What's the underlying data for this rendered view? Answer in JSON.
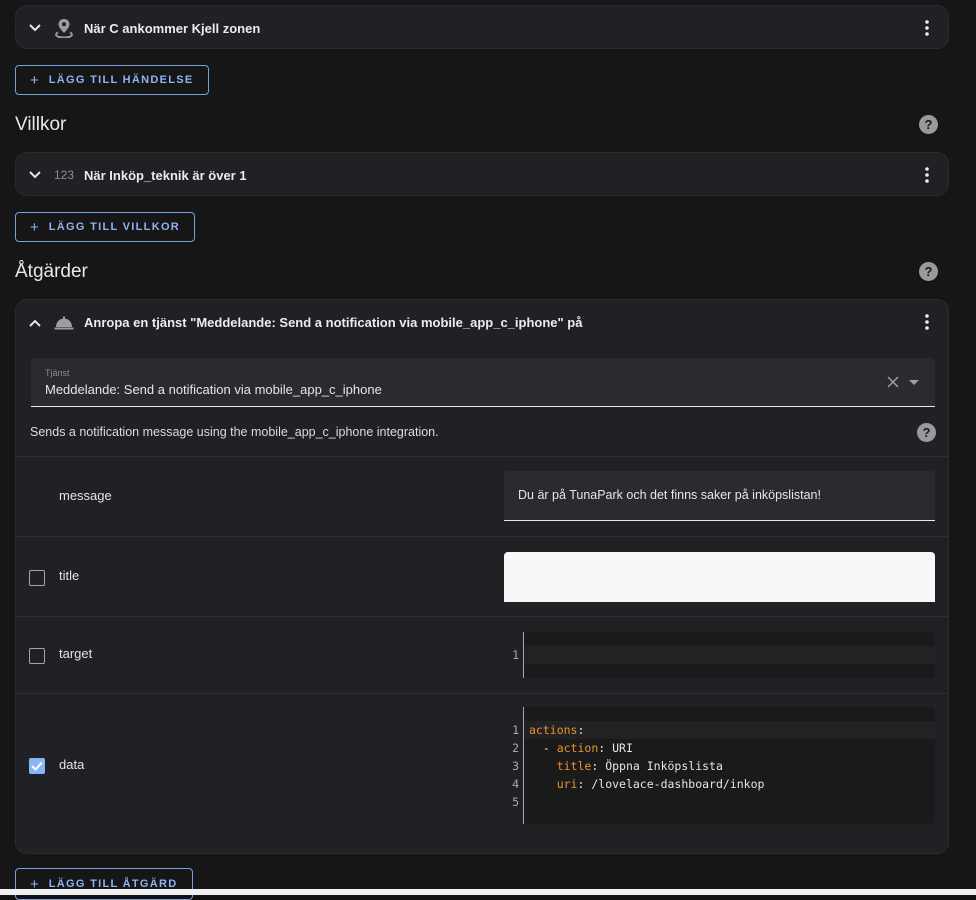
{
  "triggers": {
    "items": [
      {
        "title": "När C ankommer Kjell zonen",
        "icon": "map-marker-radius-icon",
        "expanded": false
      }
    ],
    "add_button": "LÄGG TILL HÄNDELSE"
  },
  "conditions": {
    "heading": "Villkor",
    "items": [
      {
        "title": "När Inköp_teknik är över 1",
        "icon_text": "123",
        "expanded": false
      }
    ],
    "add_button": "LÄGG TILL VILLKOR"
  },
  "actions": {
    "heading": "Åtgärder",
    "items": [
      {
        "title": "Anropa en tjänst \"Meddelande: Send a notification via mobile_app_c_iphone\" på",
        "icon": "room-service-icon",
        "expanded": true,
        "service_field": {
          "label": "Tjänst",
          "value": "Meddelande: Send a notification via mobile_app_c_iphone"
        },
        "description": "Sends a notification message using the mobile_app_c_iphone integration.",
        "fields": {
          "message": {
            "label": "message",
            "value": "Du är på TunaPark och det finns saker på inköpslistan!"
          },
          "title": {
            "label": "title",
            "checked": false,
            "value": ""
          },
          "target": {
            "label": "target",
            "checked": false,
            "line_numbers": [
              "1"
            ]
          },
          "data": {
            "label": "data",
            "checked": true,
            "line_numbers": [
              "1",
              "2",
              "3",
              "4",
              "5"
            ],
            "yaml": [
              {
                "key": "actions",
                "sep": ":",
                "value": ""
              },
              {
                "prefix": "  - ",
                "key": "action",
                "sep": ": ",
                "value": "URI"
              },
              {
                "prefix": "    ",
                "key": "title",
                "sep": ": ",
                "value": "Öppna Inköpslista"
              },
              {
                "prefix": "    ",
                "key": "uri",
                "sep": ": ",
                "value": "/lovelace-dashboard/inkop"
              },
              {
                "prefix": "",
                "key": "",
                "sep": "",
                "value": ""
              }
            ]
          }
        }
      }
    ],
    "add_button": "LÄGG TILL ÅTGÄRD"
  },
  "icons": {
    "plus": "+",
    "help": "?"
  },
  "colors": {
    "accent": "#8ab4f8",
    "yaml_key": "#e8932c",
    "card_bg": "#202124",
    "page_bg": "#161617"
  }
}
